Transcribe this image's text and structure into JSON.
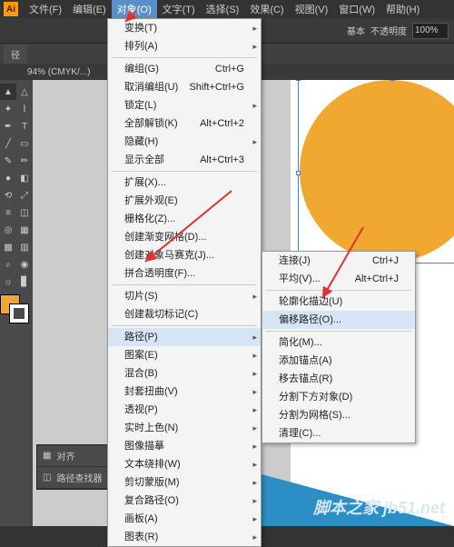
{
  "menubar": {
    "items": [
      "文件(F)",
      "编辑(E)",
      "对象(O)",
      "文字(T)",
      "选择(S)",
      "效果(C)",
      "视图(V)",
      "窗口(W)",
      "帮助(H)"
    ]
  },
  "toolbar": {
    "basic": "基本",
    "opacity_label": "不透明度",
    "opacity_value": "100%"
  },
  "tab": {
    "title": "径"
  },
  "status": {
    "zoom": "94% (CMYK/...)"
  },
  "panels": {
    "align": "对齐",
    "pathfinder": "路径查找器"
  },
  "dropdown": {
    "items": [
      {
        "label": "变换(T)",
        "sub": true
      },
      {
        "label": "排列(A)",
        "sub": true
      },
      {
        "sep": true
      },
      {
        "label": "编组(G)",
        "shortcut": "Ctrl+G"
      },
      {
        "label": "取消编组(U)",
        "shortcut": "Shift+Ctrl+G"
      },
      {
        "label": "锁定(L)",
        "sub": true
      },
      {
        "label": "全部解锁(K)",
        "shortcut": "Alt+Ctrl+2"
      },
      {
        "label": "隐藏(H)",
        "sub": true
      },
      {
        "label": "显示全部",
        "shortcut": "Alt+Ctrl+3"
      },
      {
        "sep": true
      },
      {
        "label": "扩展(X)..."
      },
      {
        "label": "扩展外观(E)"
      },
      {
        "label": "栅格化(Z)..."
      },
      {
        "label": "创建渐变网格(D)..."
      },
      {
        "label": "创建对象马赛克(J)..."
      },
      {
        "label": "拼合透明度(F)..."
      },
      {
        "sep": true
      },
      {
        "label": "切片(S)",
        "sub": true
      },
      {
        "label": "创建裁切标记(C)"
      },
      {
        "sep": true
      },
      {
        "label": "路径(P)",
        "sub": true,
        "hilite": true
      },
      {
        "label": "图案(E)",
        "sub": true
      },
      {
        "label": "混合(B)",
        "sub": true
      },
      {
        "label": "封套扭曲(V)",
        "sub": true
      },
      {
        "label": "透视(P)",
        "sub": true
      },
      {
        "label": "实时上色(N)",
        "sub": true
      },
      {
        "label": "图像描摹",
        "sub": true
      },
      {
        "label": "文本绕排(W)",
        "sub": true
      },
      {
        "label": "剪切蒙版(M)",
        "sub": true
      },
      {
        "label": "复合路径(O)",
        "sub": true
      },
      {
        "label": "画板(A)",
        "sub": true
      },
      {
        "label": "图表(R)",
        "sub": true
      }
    ]
  },
  "submenu": {
    "items": [
      {
        "label": "连接(J)",
        "shortcut": "Ctrl+J"
      },
      {
        "label": "平均(V)...",
        "shortcut": "Alt+Ctrl+J"
      },
      {
        "sep": true
      },
      {
        "label": "轮廓化描边(U)"
      },
      {
        "label": "偏移路径(O)...",
        "hilite": true
      },
      {
        "sep": true
      },
      {
        "label": "简化(M)..."
      },
      {
        "label": "添加锚点(A)"
      },
      {
        "label": "移去锚点(R)"
      },
      {
        "label": "分割下方对象(D)"
      },
      {
        "label": "分割为网格(S)..."
      },
      {
        "label": "清理(C)..."
      }
    ]
  },
  "banner": {
    "text": "脚本之家 jb51.net"
  }
}
